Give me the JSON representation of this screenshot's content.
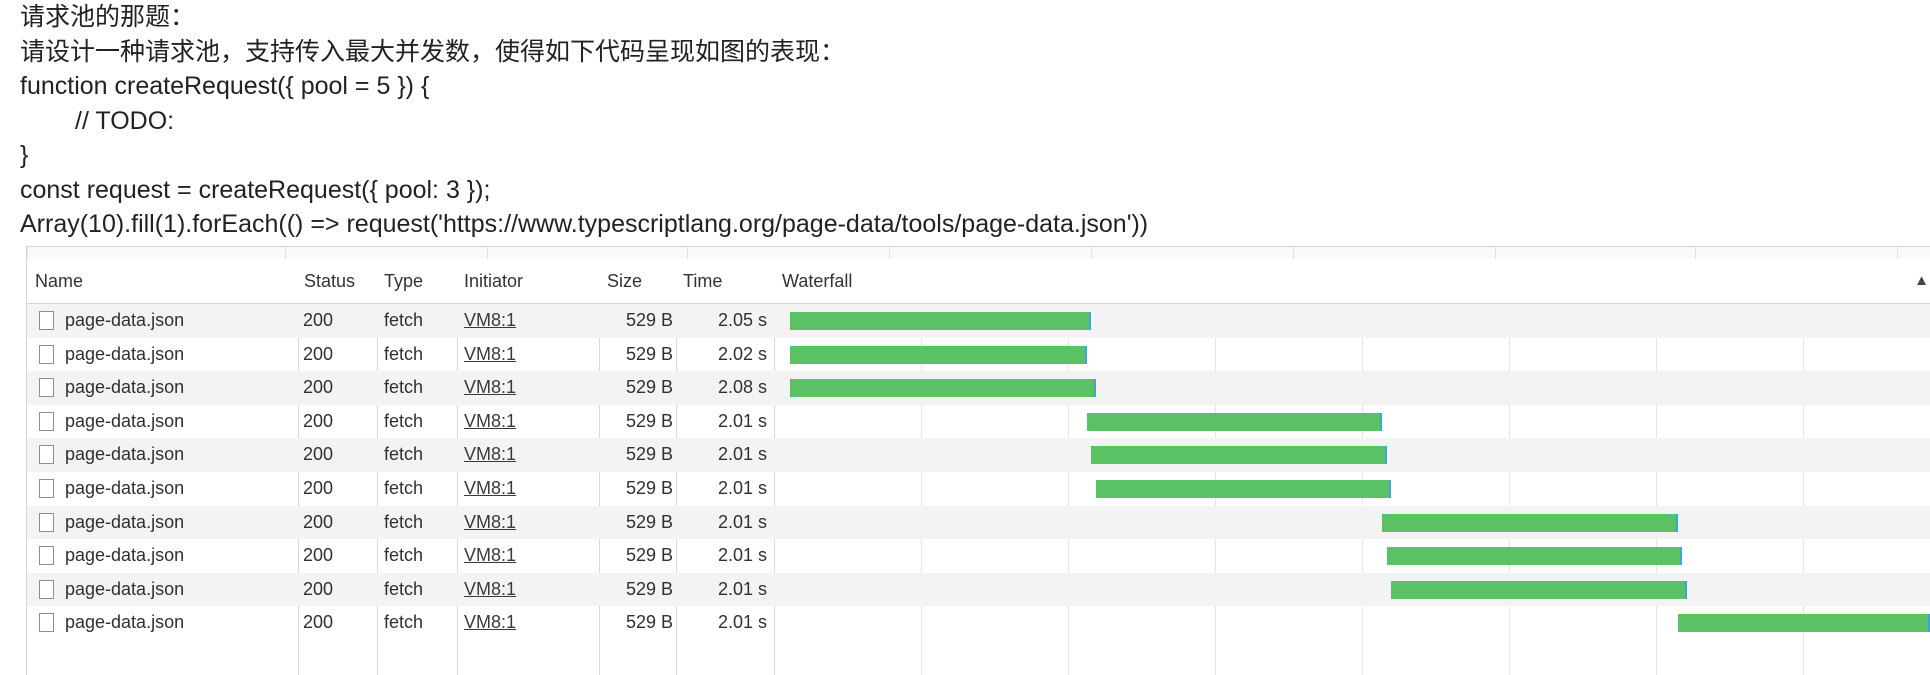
{
  "question": {
    "lines": [
      "请求池的那题：",
      "请设计一种请求池，支持传入最大并发数，使得如下代码呈现如图的表现：",
      "function createRequest({ pool = 5 }) {",
      "// TODO:",
      "}",
      "const request = createRequest({ pool: 3 });",
      "Array(10).fill(1).forEach(() => request('https://www.typescriptlang.org/page-data/tools/page-data.json'))"
    ]
  },
  "network": {
    "columns": {
      "name": "Name",
      "status": "Status",
      "type": "Type",
      "initiator": "Initiator",
      "size": "Size",
      "time": "Time",
      "waterfall": "Waterfall"
    },
    "sort_icon": "▲",
    "rows": [
      {
        "name": "page-data.json",
        "status": "200",
        "type": "fetch",
        "initiator": "VM8:1",
        "size": "529 B",
        "time": "2.05 s",
        "start": 0.0,
        "end": 2.05
      },
      {
        "name": "page-data.json",
        "status": "200",
        "type": "fetch",
        "initiator": "VM8:1",
        "size": "529 B",
        "time": "2.02 s",
        "start": 0.0,
        "end": 2.02
      },
      {
        "name": "page-data.json",
        "status": "200",
        "type": "fetch",
        "initiator": "VM8:1",
        "size": "529 B",
        "time": "2.08 s",
        "start": 0.0,
        "end": 2.08
      },
      {
        "name": "page-data.json",
        "status": "200",
        "type": "fetch",
        "initiator": "VM8:1",
        "size": "529 B",
        "time": "2.01 s",
        "start": 2.02,
        "end": 4.03
      },
      {
        "name": "page-data.json",
        "status": "200",
        "type": "fetch",
        "initiator": "VM8:1",
        "size": "529 B",
        "time": "2.01 s",
        "start": 2.05,
        "end": 4.06
      },
      {
        "name": "page-data.json",
        "status": "200",
        "type": "fetch",
        "initiator": "VM8:1",
        "size": "529 B",
        "time": "2.01 s",
        "start": 2.08,
        "end": 4.09
      },
      {
        "name": "page-data.json",
        "status": "200",
        "type": "fetch",
        "initiator": "VM8:1",
        "size": "529 B",
        "time": "2.01 s",
        "start": 4.03,
        "end": 6.04
      },
      {
        "name": "page-data.json",
        "status": "200",
        "type": "fetch",
        "initiator": "VM8:1",
        "size": "529 B",
        "time": "2.01 s",
        "start": 4.06,
        "end": 6.07
      },
      {
        "name": "page-data.json",
        "status": "200",
        "type": "fetch",
        "initiator": "VM8:1",
        "size": "529 B",
        "time": "2.01 s",
        "start": 4.09,
        "end": 6.1
      },
      {
        "name": "page-data.json",
        "status": "200",
        "type": "fetch",
        "initiator": "VM8:1",
        "size": "529 B",
        "time": "2.01 s",
        "start": 6.04,
        "end": 8.05
      }
    ],
    "bar_color": "#5bc165",
    "bar_edge_color": "#3fa3dc"
  }
}
